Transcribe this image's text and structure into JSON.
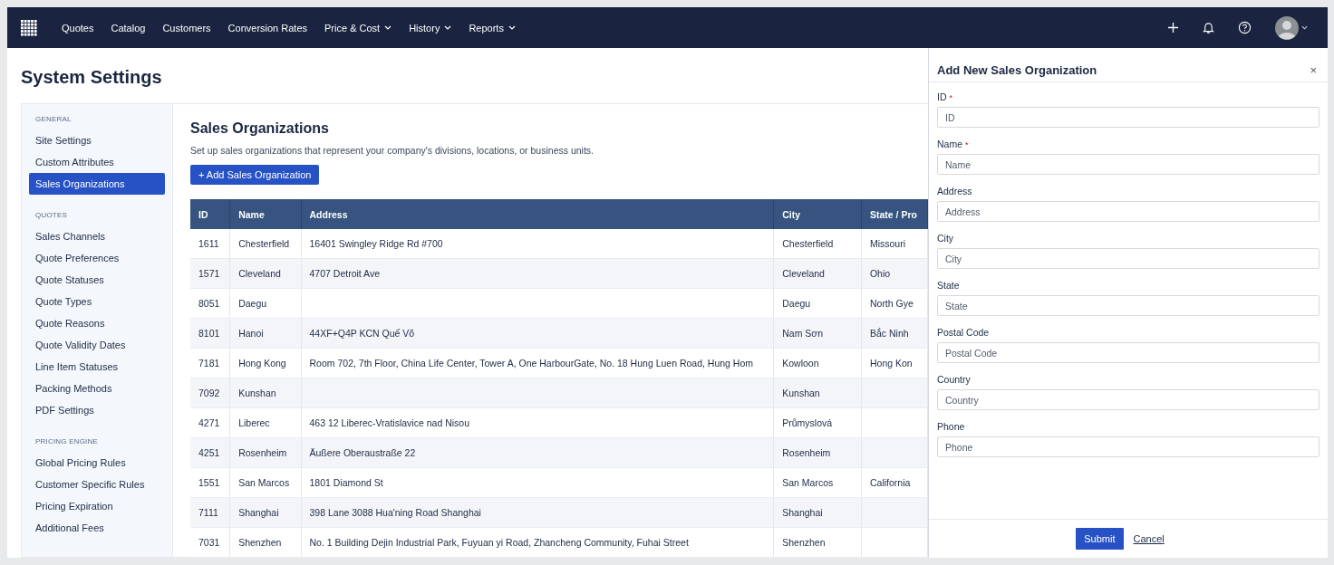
{
  "nav": {
    "items": [
      {
        "label": "Quotes",
        "dropdown": false
      },
      {
        "label": "Catalog",
        "dropdown": false
      },
      {
        "label": "Customers",
        "dropdown": false
      },
      {
        "label": "Conversion Rates",
        "dropdown": false
      },
      {
        "label": "Price & Cost",
        "dropdown": true
      },
      {
        "label": "History",
        "dropdown": true
      },
      {
        "label": "Reports",
        "dropdown": true
      }
    ]
  },
  "page_title": "System Settings",
  "sidebar": {
    "sections": [
      {
        "heading": "GENERAL",
        "items": [
          {
            "label": "Site Settings",
            "selected": false
          },
          {
            "label": "Custom Attributes",
            "selected": false
          },
          {
            "label": "Sales Organizations",
            "selected": true
          }
        ]
      },
      {
        "heading": "QUOTES",
        "items": [
          {
            "label": "Sales Channels",
            "selected": false
          },
          {
            "label": "Quote Preferences",
            "selected": false
          },
          {
            "label": "Quote Statuses",
            "selected": false
          },
          {
            "label": "Quote Types",
            "selected": false
          },
          {
            "label": "Quote Reasons",
            "selected": false
          },
          {
            "label": "Quote Validity Dates",
            "selected": false
          },
          {
            "label": "Line Item Statuses",
            "selected": false
          },
          {
            "label": "Packing Methods",
            "selected": false
          },
          {
            "label": "PDF Settings",
            "selected": false
          }
        ]
      },
      {
        "heading": "PRICING ENGINE",
        "items": [
          {
            "label": "Global Pricing Rules",
            "selected": false
          },
          {
            "label": "Customer Specific Rules",
            "selected": false
          },
          {
            "label": "Pricing Expiration",
            "selected": false
          },
          {
            "label": "Additional Fees",
            "selected": false
          }
        ]
      }
    ]
  },
  "content": {
    "title": "Sales Organizations",
    "description": "Set up sales organizations that represent your company's divisions, locations, or business units.",
    "add_button": "+ Add Sales Organization"
  },
  "table": {
    "columns": [
      "ID",
      "Name",
      "Address",
      "City",
      "State / Pro"
    ],
    "rows": [
      [
        "1611",
        "Chesterfield",
        "16401 Swingley Ridge Rd #700",
        "Chesterfield",
        "Missouri"
      ],
      [
        "1571",
        "Cleveland",
        "4707 Detroit Ave",
        "Cleveland",
        "Ohio"
      ],
      [
        "8051",
        "Daegu",
        "",
        "Daegu",
        "North Gye"
      ],
      [
        "8101",
        "Hanoi",
        "44XF+Q4P KCN Quế Võ",
        "Nam Sơn",
        "Bắc Ninh"
      ],
      [
        "7181",
        "Hong Kong",
        "Room 702, 7th Floor, China Life Center, Tower A, One HarbourGate, No. 18 Hung Luen Road, Hung Hom",
        "Kowloon",
        "Hong Kon"
      ],
      [
        "7092",
        "Kunshan",
        "",
        "Kunshan",
        ""
      ],
      [
        "4271",
        "Liberec",
        "463 12 Liberec-Vratislavice nad Nisou",
        "Průmyslová",
        ""
      ],
      [
        "4251",
        "Rosenheim",
        "Äußere Oberaustraße 22",
        "Rosenheim",
        ""
      ],
      [
        "1551",
        "San Marcos",
        "1801 Diamond St",
        "San Marcos",
        "California"
      ],
      [
        "7111",
        "Shanghai",
        "398 Lane 3088 Hua'ning Road Shanghai",
        "Shanghai",
        ""
      ],
      [
        "7031",
        "Shenzhen",
        "No. 1 Building Dejin Industrial Park, Fuyuan yi Road, Zhancheng Community, Fuhai Street",
        "Shenzhen",
        ""
      ]
    ]
  },
  "drawer": {
    "title": "Add New Sales Organization",
    "close": "×",
    "fields": [
      {
        "label": "ID",
        "required_mark": "*",
        "placeholder": "ID"
      },
      {
        "label": "Name",
        "required_mark": "*",
        "placeholder": "Name"
      },
      {
        "label": "Address",
        "placeholder": "Address"
      },
      {
        "label": "City",
        "placeholder": "City"
      },
      {
        "label": "State",
        "placeholder": "State"
      },
      {
        "label": "Postal Code",
        "placeholder": "Postal Code"
      },
      {
        "label": "Country",
        "placeholder": "Country"
      },
      {
        "label": "Phone",
        "placeholder": "Phone"
      }
    ],
    "submit": "Submit",
    "cancel": "Cancel"
  }
}
